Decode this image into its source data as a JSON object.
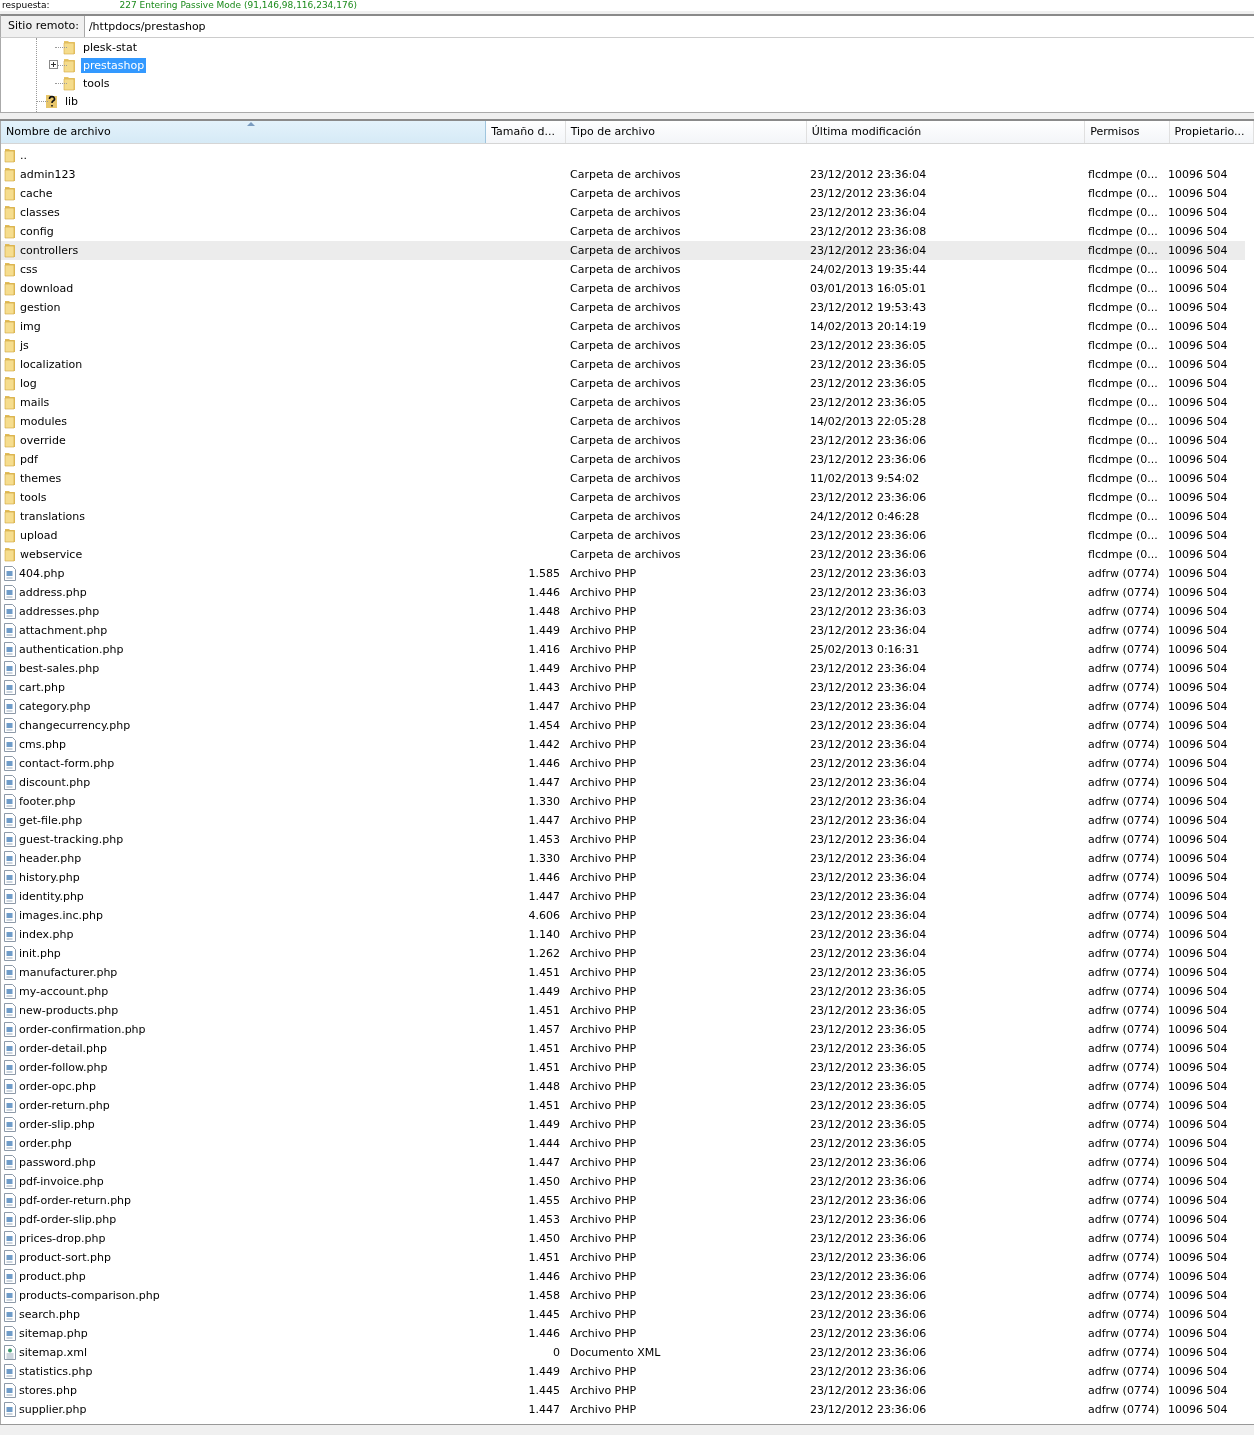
{
  "log_line": {
    "label": "respuesta:",
    "message": "227 Entering Passive Mode (91,146,98,116,234,176)"
  },
  "remote_site": {
    "label": "Sitio remoto:",
    "value": "/httpdocs/prestashop"
  },
  "tree": {
    "nested_items": [
      {
        "label": "plesk-stat",
        "kind": "folder",
        "selected": false,
        "expandable": false
      },
      {
        "label": "prestashop",
        "kind": "folder",
        "selected": true,
        "expandable": true
      },
      {
        "label": "tools",
        "kind": "folder",
        "selected": false,
        "expandable": false
      }
    ],
    "outer_items": [
      {
        "label": "lib",
        "kind": "unknown",
        "selected": false
      }
    ]
  },
  "columns": [
    "Nombre de archivo",
    "Tamaño d...",
    "Tipo de archivo",
    "Última modificación",
    "Permisos",
    "Propietario..."
  ],
  "rows": [
    {
      "kind": "parent",
      "name": "..",
      "selected": false
    },
    {
      "kind": "folder",
      "name": "admin123",
      "size": "",
      "type": "Carpeta de archivos",
      "modified": "23/12/2012 23:36:04",
      "perms": "flcdmpe (0...",
      "owner": "10096 504",
      "selected": false
    },
    {
      "kind": "folder",
      "name": "cache",
      "size": "",
      "type": "Carpeta de archivos",
      "modified": "23/12/2012 23:36:04",
      "perms": "flcdmpe (0...",
      "owner": "10096 504",
      "selected": false
    },
    {
      "kind": "folder",
      "name": "classes",
      "size": "",
      "type": "Carpeta de archivos",
      "modified": "23/12/2012 23:36:04",
      "perms": "flcdmpe (0...",
      "owner": "10096 504",
      "selected": false
    },
    {
      "kind": "folder",
      "name": "config",
      "size": "",
      "type": "Carpeta de archivos",
      "modified": "23/12/2012 23:36:08",
      "perms": "flcdmpe (0...",
      "owner": "10096 504",
      "selected": false
    },
    {
      "kind": "folder",
      "name": "controllers",
      "size": "",
      "type": "Carpeta de archivos",
      "modified": "23/12/2012 23:36:04",
      "perms": "flcdmpe (0...",
      "owner": "10096 504",
      "selected": true
    },
    {
      "kind": "folder",
      "name": "css",
      "size": "",
      "type": "Carpeta de archivos",
      "modified": "24/02/2013 19:35:44",
      "perms": "flcdmpe (0...",
      "owner": "10096 504",
      "selected": false
    },
    {
      "kind": "folder",
      "name": "download",
      "size": "",
      "type": "Carpeta de archivos",
      "modified": "03/01/2013 16:05:01",
      "perms": "flcdmpe (0...",
      "owner": "10096 504",
      "selected": false
    },
    {
      "kind": "folder",
      "name": "gestion",
      "size": "",
      "type": "Carpeta de archivos",
      "modified": "23/12/2012 19:53:43",
      "perms": "flcdmpe (0...",
      "owner": "10096 504",
      "selected": false
    },
    {
      "kind": "folder",
      "name": "img",
      "size": "",
      "type": "Carpeta de archivos",
      "modified": "14/02/2013 20:14:19",
      "perms": "flcdmpe (0...",
      "owner": "10096 504",
      "selected": false
    },
    {
      "kind": "folder",
      "name": "js",
      "size": "",
      "type": "Carpeta de archivos",
      "modified": "23/12/2012 23:36:05",
      "perms": "flcdmpe (0...",
      "owner": "10096 504",
      "selected": false
    },
    {
      "kind": "folder",
      "name": "localization",
      "size": "",
      "type": "Carpeta de archivos",
      "modified": "23/12/2012 23:36:05",
      "perms": "flcdmpe (0...",
      "owner": "10096 504",
      "selected": false
    },
    {
      "kind": "folder",
      "name": "log",
      "size": "",
      "type": "Carpeta de archivos",
      "modified": "23/12/2012 23:36:05",
      "perms": "flcdmpe (0...",
      "owner": "10096 504",
      "selected": false
    },
    {
      "kind": "folder",
      "name": "mails",
      "size": "",
      "type": "Carpeta de archivos",
      "modified": "23/12/2012 23:36:05",
      "perms": "flcdmpe (0...",
      "owner": "10096 504",
      "selected": false
    },
    {
      "kind": "folder",
      "name": "modules",
      "size": "",
      "type": "Carpeta de archivos",
      "modified": "14/02/2013 22:05:28",
      "perms": "flcdmpe (0...",
      "owner": "10096 504",
      "selected": false
    },
    {
      "kind": "folder",
      "name": "override",
      "size": "",
      "type": "Carpeta de archivos",
      "modified": "23/12/2012 23:36:06",
      "perms": "flcdmpe (0...",
      "owner": "10096 504",
      "selected": false
    },
    {
      "kind": "folder",
      "name": "pdf",
      "size": "",
      "type": "Carpeta de archivos",
      "modified": "23/12/2012 23:36:06",
      "perms": "flcdmpe (0...",
      "owner": "10096 504",
      "selected": false
    },
    {
      "kind": "folder",
      "name": "themes",
      "size": "",
      "type": "Carpeta de archivos",
      "modified": "11/02/2013 9:54:02",
      "perms": "flcdmpe (0...",
      "owner": "10096 504",
      "selected": false
    },
    {
      "kind": "folder",
      "name": "tools",
      "size": "",
      "type": "Carpeta de archivos",
      "modified": "23/12/2012 23:36:06",
      "perms": "flcdmpe (0...",
      "owner": "10096 504",
      "selected": false
    },
    {
      "kind": "folder",
      "name": "translations",
      "size": "",
      "type": "Carpeta de archivos",
      "modified": "24/12/2012 0:46:28",
      "perms": "flcdmpe (0...",
      "owner": "10096 504",
      "selected": false
    },
    {
      "kind": "folder",
      "name": "upload",
      "size": "",
      "type": "Carpeta de archivos",
      "modified": "23/12/2012 23:36:06",
      "perms": "flcdmpe (0...",
      "owner": "10096 504",
      "selected": false
    },
    {
      "kind": "folder",
      "name": "webservice",
      "size": "",
      "type": "Carpeta de archivos",
      "modified": "23/12/2012 23:36:06",
      "perms": "flcdmpe (0...",
      "owner": "10096 504",
      "selected": false
    },
    {
      "kind": "php",
      "name": "404.php",
      "size": "1.585",
      "type": "Archivo PHP",
      "modified": "23/12/2012 23:36:03",
      "perms": "adfrw (0774)",
      "owner": "10096 504",
      "selected": false
    },
    {
      "kind": "php",
      "name": "address.php",
      "size": "1.446",
      "type": "Archivo PHP",
      "modified": "23/12/2012 23:36:03",
      "perms": "adfrw (0774)",
      "owner": "10096 504",
      "selected": false
    },
    {
      "kind": "php",
      "name": "addresses.php",
      "size": "1.448",
      "type": "Archivo PHP",
      "modified": "23/12/2012 23:36:03",
      "perms": "adfrw (0774)",
      "owner": "10096 504",
      "selected": false
    },
    {
      "kind": "php",
      "name": "attachment.php",
      "size": "1.449",
      "type": "Archivo PHP",
      "modified": "23/12/2012 23:36:04",
      "perms": "adfrw (0774)",
      "owner": "10096 504",
      "selected": false
    },
    {
      "kind": "php",
      "name": "authentication.php",
      "size": "1.416",
      "type": "Archivo PHP",
      "modified": "25/02/2013 0:16:31",
      "perms": "adfrw (0774)",
      "owner": "10096 504",
      "selected": false
    },
    {
      "kind": "php",
      "name": "best-sales.php",
      "size": "1.449",
      "type": "Archivo PHP",
      "modified": "23/12/2012 23:36:04",
      "perms": "adfrw (0774)",
      "owner": "10096 504",
      "selected": false
    },
    {
      "kind": "php",
      "name": "cart.php",
      "size": "1.443",
      "type": "Archivo PHP",
      "modified": "23/12/2012 23:36:04",
      "perms": "adfrw (0774)",
      "owner": "10096 504",
      "selected": false
    },
    {
      "kind": "php",
      "name": "category.php",
      "size": "1.447",
      "type": "Archivo PHP",
      "modified": "23/12/2012 23:36:04",
      "perms": "adfrw (0774)",
      "owner": "10096 504",
      "selected": false
    },
    {
      "kind": "php",
      "name": "changecurrency.php",
      "size": "1.454",
      "type": "Archivo PHP",
      "modified": "23/12/2012 23:36:04",
      "perms": "adfrw (0774)",
      "owner": "10096 504",
      "selected": false
    },
    {
      "kind": "php",
      "name": "cms.php",
      "size": "1.442",
      "type": "Archivo PHP",
      "modified": "23/12/2012 23:36:04",
      "perms": "adfrw (0774)",
      "owner": "10096 504",
      "selected": false
    },
    {
      "kind": "php",
      "name": "contact-form.php",
      "size": "1.446",
      "type": "Archivo PHP",
      "modified": "23/12/2012 23:36:04",
      "perms": "adfrw (0774)",
      "owner": "10096 504",
      "selected": false
    },
    {
      "kind": "php",
      "name": "discount.php",
      "size": "1.447",
      "type": "Archivo PHP",
      "modified": "23/12/2012 23:36:04",
      "perms": "adfrw (0774)",
      "owner": "10096 504",
      "selected": false
    },
    {
      "kind": "php",
      "name": "footer.php",
      "size": "1.330",
      "type": "Archivo PHP",
      "modified": "23/12/2012 23:36:04",
      "perms": "adfrw (0774)",
      "owner": "10096 504",
      "selected": false
    },
    {
      "kind": "php",
      "name": "get-file.php",
      "size": "1.447",
      "type": "Archivo PHP",
      "modified": "23/12/2012 23:36:04",
      "perms": "adfrw (0774)",
      "owner": "10096 504",
      "selected": false
    },
    {
      "kind": "php",
      "name": "guest-tracking.php",
      "size": "1.453",
      "type": "Archivo PHP",
      "modified": "23/12/2012 23:36:04",
      "perms": "adfrw (0774)",
      "owner": "10096 504",
      "selected": false
    },
    {
      "kind": "php",
      "name": "header.php",
      "size": "1.330",
      "type": "Archivo PHP",
      "modified": "23/12/2012 23:36:04",
      "perms": "adfrw (0774)",
      "owner": "10096 504",
      "selected": false
    },
    {
      "kind": "php",
      "name": "history.php",
      "size": "1.446",
      "type": "Archivo PHP",
      "modified": "23/12/2012 23:36:04",
      "perms": "adfrw (0774)",
      "owner": "10096 504",
      "selected": false
    },
    {
      "kind": "php",
      "name": "identity.php",
      "size": "1.447",
      "type": "Archivo PHP",
      "modified": "23/12/2012 23:36:04",
      "perms": "adfrw (0774)",
      "owner": "10096 504",
      "selected": false
    },
    {
      "kind": "php",
      "name": "images.inc.php",
      "size": "4.606",
      "type": "Archivo PHP",
      "modified": "23/12/2012 23:36:04",
      "perms": "adfrw (0774)",
      "owner": "10096 504",
      "selected": false
    },
    {
      "kind": "php",
      "name": "index.php",
      "size": "1.140",
      "type": "Archivo PHP",
      "modified": "23/12/2012 23:36:04",
      "perms": "adfrw (0774)",
      "owner": "10096 504",
      "selected": false
    },
    {
      "kind": "php",
      "name": "init.php",
      "size": "1.262",
      "type": "Archivo PHP",
      "modified": "23/12/2012 23:36:04",
      "perms": "adfrw (0774)",
      "owner": "10096 504",
      "selected": false
    },
    {
      "kind": "php",
      "name": "manufacturer.php",
      "size": "1.451",
      "type": "Archivo PHP",
      "modified": "23/12/2012 23:36:05",
      "perms": "adfrw (0774)",
      "owner": "10096 504",
      "selected": false
    },
    {
      "kind": "php",
      "name": "my-account.php",
      "size": "1.449",
      "type": "Archivo PHP",
      "modified": "23/12/2012 23:36:05",
      "perms": "adfrw (0774)",
      "owner": "10096 504",
      "selected": false
    },
    {
      "kind": "php",
      "name": "new-products.php",
      "size": "1.451",
      "type": "Archivo PHP",
      "modified": "23/12/2012 23:36:05",
      "perms": "adfrw (0774)",
      "owner": "10096 504",
      "selected": false
    },
    {
      "kind": "php",
      "name": "order-confirmation.php",
      "size": "1.457",
      "type": "Archivo PHP",
      "modified": "23/12/2012 23:36:05",
      "perms": "adfrw (0774)",
      "owner": "10096 504",
      "selected": false
    },
    {
      "kind": "php",
      "name": "order-detail.php",
      "size": "1.451",
      "type": "Archivo PHP",
      "modified": "23/12/2012 23:36:05",
      "perms": "adfrw (0774)",
      "owner": "10096 504",
      "selected": false
    },
    {
      "kind": "php",
      "name": "order-follow.php",
      "size": "1.451",
      "type": "Archivo PHP",
      "modified": "23/12/2012 23:36:05",
      "perms": "adfrw (0774)",
      "owner": "10096 504",
      "selected": false
    },
    {
      "kind": "php",
      "name": "order-opc.php",
      "size": "1.448",
      "type": "Archivo PHP",
      "modified": "23/12/2012 23:36:05",
      "perms": "adfrw (0774)",
      "owner": "10096 504",
      "selected": false
    },
    {
      "kind": "php",
      "name": "order-return.php",
      "size": "1.451",
      "type": "Archivo PHP",
      "modified": "23/12/2012 23:36:05",
      "perms": "adfrw (0774)",
      "owner": "10096 504",
      "selected": false
    },
    {
      "kind": "php",
      "name": "order-slip.php",
      "size": "1.449",
      "type": "Archivo PHP",
      "modified": "23/12/2012 23:36:05",
      "perms": "adfrw (0774)",
      "owner": "10096 504",
      "selected": false
    },
    {
      "kind": "php",
      "name": "order.php",
      "size": "1.444",
      "type": "Archivo PHP",
      "modified": "23/12/2012 23:36:05",
      "perms": "adfrw (0774)",
      "owner": "10096 504",
      "selected": false
    },
    {
      "kind": "php",
      "name": "password.php",
      "size": "1.447",
      "type": "Archivo PHP",
      "modified": "23/12/2012 23:36:06",
      "perms": "adfrw (0774)",
      "owner": "10096 504",
      "selected": false
    },
    {
      "kind": "php",
      "name": "pdf-invoice.php",
      "size": "1.450",
      "type": "Archivo PHP",
      "modified": "23/12/2012 23:36:06",
      "perms": "adfrw (0774)",
      "owner": "10096 504",
      "selected": false
    },
    {
      "kind": "php",
      "name": "pdf-order-return.php",
      "size": "1.455",
      "type": "Archivo PHP",
      "modified": "23/12/2012 23:36:06",
      "perms": "adfrw (0774)",
      "owner": "10096 504",
      "selected": false
    },
    {
      "kind": "php",
      "name": "pdf-order-slip.php",
      "size": "1.453",
      "type": "Archivo PHP",
      "modified": "23/12/2012 23:36:06",
      "perms": "adfrw (0774)",
      "owner": "10096 504",
      "selected": false
    },
    {
      "kind": "php",
      "name": "prices-drop.php",
      "size": "1.450",
      "type": "Archivo PHP",
      "modified": "23/12/2012 23:36:06",
      "perms": "adfrw (0774)",
      "owner": "10096 504",
      "selected": false
    },
    {
      "kind": "php",
      "name": "product-sort.php",
      "size": "1.451",
      "type": "Archivo PHP",
      "modified": "23/12/2012 23:36:06",
      "perms": "adfrw (0774)",
      "owner": "10096 504",
      "selected": false
    },
    {
      "kind": "php",
      "name": "product.php",
      "size": "1.446",
      "type": "Archivo PHP",
      "modified": "23/12/2012 23:36:06",
      "perms": "adfrw (0774)",
      "owner": "10096 504",
      "selected": false
    },
    {
      "kind": "php",
      "name": "products-comparison.php",
      "size": "1.458",
      "type": "Archivo PHP",
      "modified": "23/12/2012 23:36:06",
      "perms": "adfrw (0774)",
      "owner": "10096 504",
      "selected": false
    },
    {
      "kind": "php",
      "name": "search.php",
      "size": "1.445",
      "type": "Archivo PHP",
      "modified": "23/12/2012 23:36:06",
      "perms": "adfrw (0774)",
      "owner": "10096 504",
      "selected": false
    },
    {
      "kind": "php",
      "name": "sitemap.php",
      "size": "1.446",
      "type": "Archivo PHP",
      "modified": "23/12/2012 23:36:06",
      "perms": "adfrw (0774)",
      "owner": "10096 504",
      "selected": false
    },
    {
      "kind": "xml",
      "name": "sitemap.xml",
      "size": "0",
      "type": "Documento XML",
      "modified": "23/12/2012 23:36:06",
      "perms": "adfrw (0774)",
      "owner": "10096 504",
      "selected": false
    },
    {
      "kind": "php",
      "name": "statistics.php",
      "size": "1.449",
      "type": "Archivo PHP",
      "modified": "23/12/2012 23:36:06",
      "perms": "adfrw (0774)",
      "owner": "10096 504",
      "selected": false
    },
    {
      "kind": "php",
      "name": "stores.php",
      "size": "1.445",
      "type": "Archivo PHP",
      "modified": "23/12/2012 23:36:06",
      "perms": "adfrw (0774)",
      "owner": "10096 504",
      "selected": false
    },
    {
      "kind": "php",
      "name": "supplier.php",
      "size": "1.447",
      "type": "Archivo PHP",
      "modified": "23/12/2012 23:36:06",
      "perms": "adfrw (0774)",
      "owner": "10096 504",
      "selected": false
    }
  ]
}
